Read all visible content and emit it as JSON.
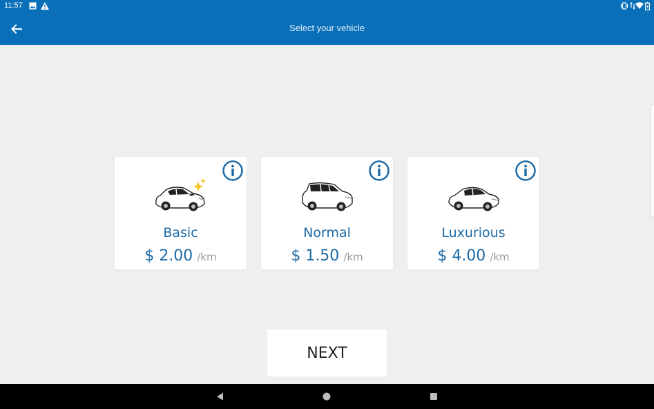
{
  "status_bar": {
    "time": "11:57",
    "left_icons": [
      "image-icon",
      "warning-icon"
    ],
    "right_icons": [
      "vibrate-icon",
      "data-transfer-icon",
      "wifi-icon",
      "battery-icon"
    ]
  },
  "app_bar": {
    "title": "Select your vehicle",
    "back_icon": "arrow-left-icon",
    "color": "#0a6fb9"
  },
  "vehicles": [
    {
      "name": "Basic",
      "price": "$ 2.00",
      "unit": "/km",
      "icon": "car-sparkle-icon"
    },
    {
      "name": "Normal",
      "price": "$ 1.50",
      "unit": "/km",
      "icon": "suv-icon"
    },
    {
      "name": "Luxurious",
      "price": "$ 4.00",
      "unit": "/km",
      "icon": "sedan-icon"
    }
  ],
  "next_button": {
    "label": "NEXT"
  },
  "accent_color": "#1c6aa6",
  "nav_bar": {
    "buttons": [
      "back-triangle-icon",
      "home-circle-icon",
      "recents-square-icon"
    ]
  }
}
